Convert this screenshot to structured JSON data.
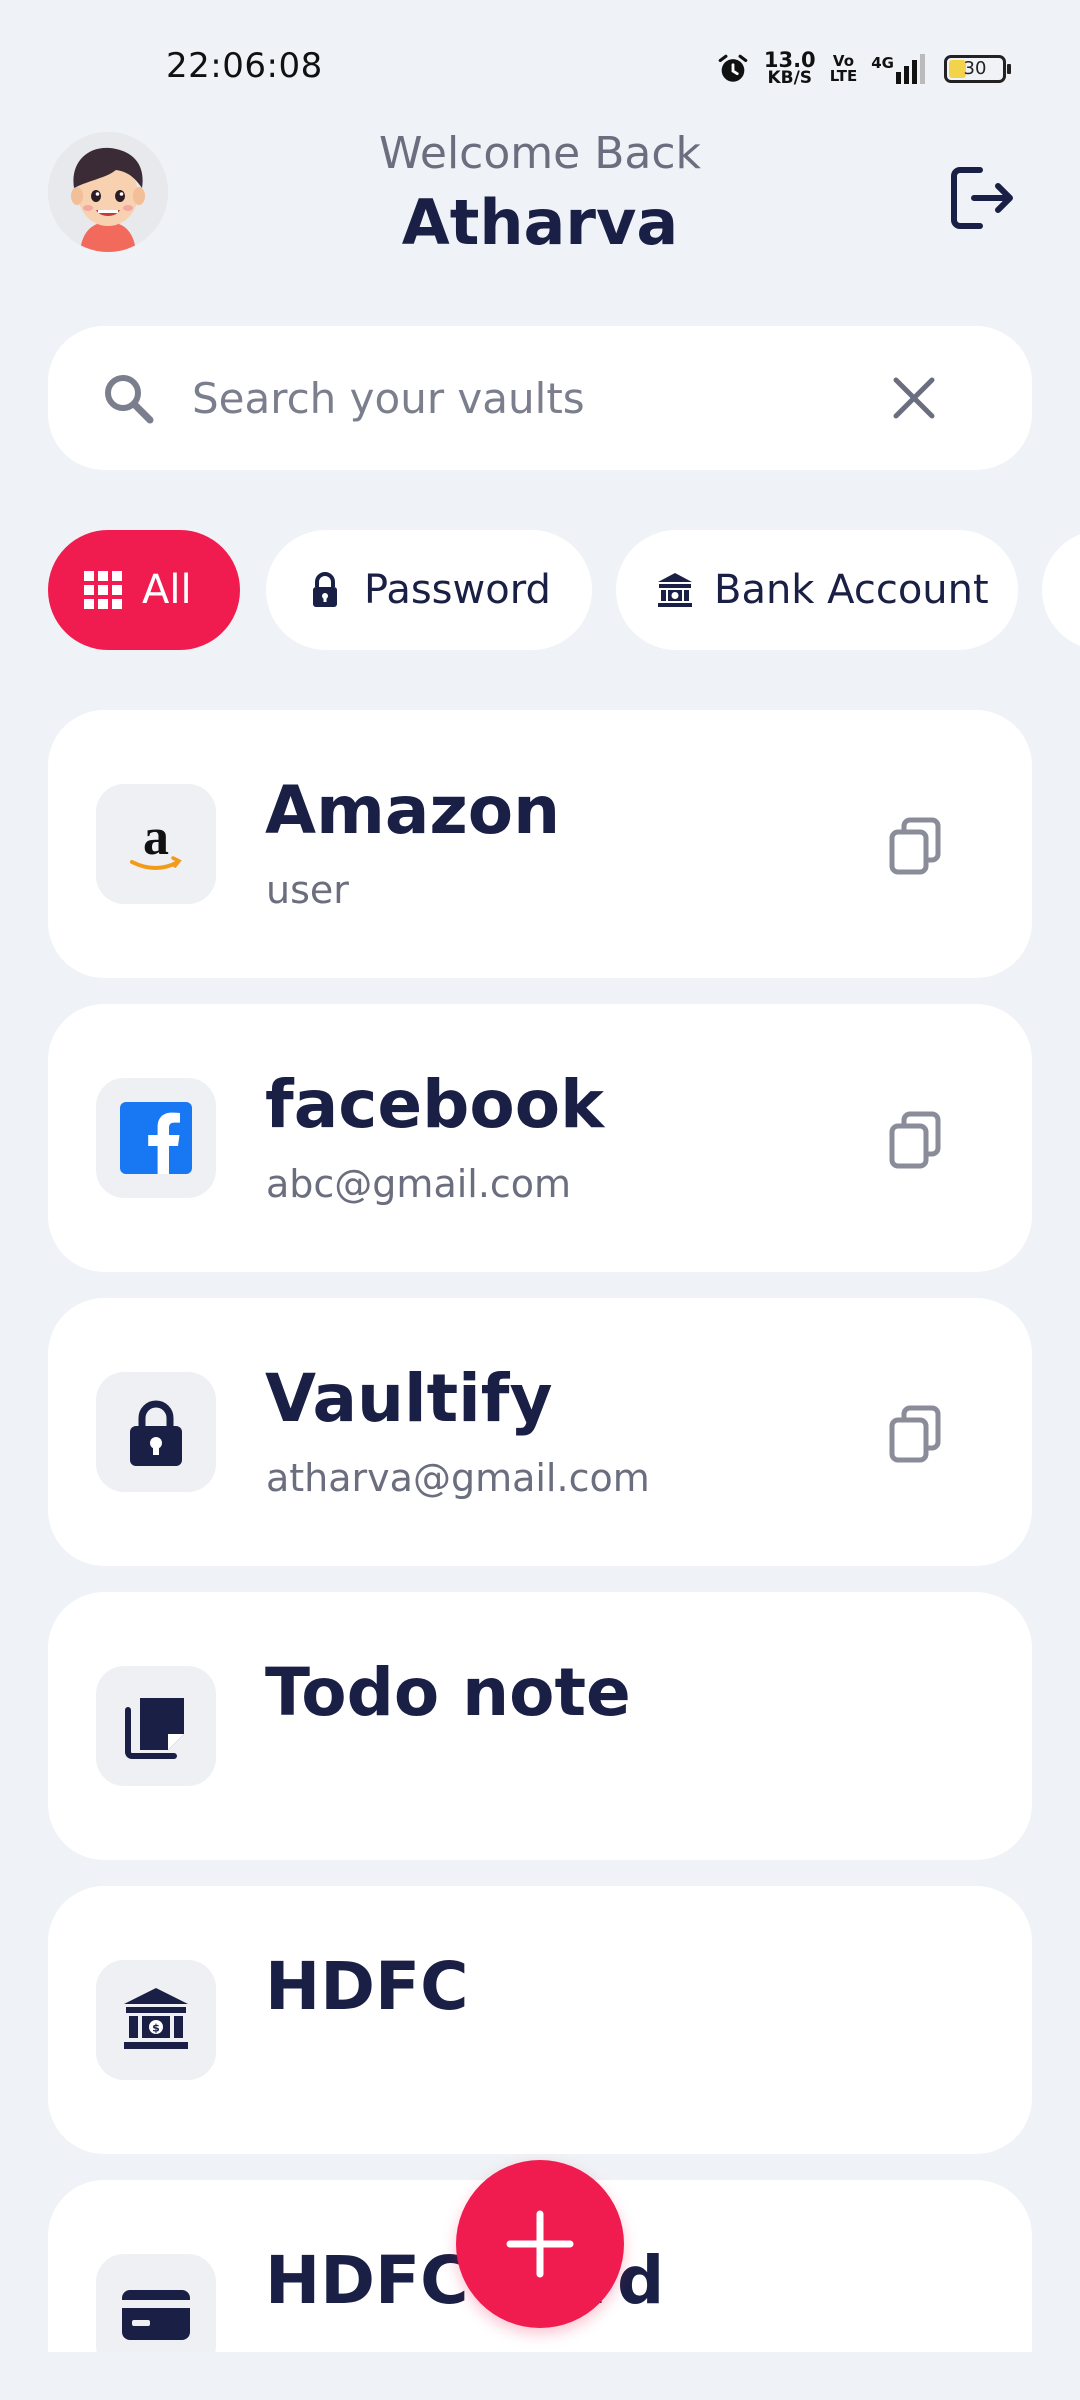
{
  "status_bar": {
    "time": "22:06:08",
    "net_speed_value": "13.0",
    "net_speed_unit": "KB/S",
    "volte_top": "Vo",
    "volte_bottom": "LTE",
    "network": "4G",
    "battery": "30",
    "icons": [
      "alarm-icon",
      "signal-icon",
      "battery-icon"
    ]
  },
  "header": {
    "welcome": "Welcome Back",
    "username": "Atharva",
    "avatar": "avatar-boy",
    "logout_icon": "logout-icon"
  },
  "search": {
    "placeholder": "Search your vaults",
    "value": "",
    "icon": "search-icon",
    "clear_icon": "close-icon"
  },
  "filters": [
    {
      "label": "All",
      "icon": "grid-icon",
      "active": true
    },
    {
      "label": "Password",
      "icon": "lock-icon",
      "active": false
    },
    {
      "label": "Bank Account",
      "icon": "bank-icon",
      "active": false
    }
  ],
  "vaults": [
    {
      "title": "Amazon",
      "subtitle": "user",
      "icon": "amazon-icon",
      "copyable": true
    },
    {
      "title": "facebook",
      "subtitle": "abc@gmail.com",
      "icon": "facebook-icon",
      "copyable": true
    },
    {
      "title": "Vaultify",
      "subtitle": "atharva@gmail.com",
      "icon": "lock-icon",
      "copyable": true
    },
    {
      "title": "Todo note",
      "subtitle": "",
      "icon": "note-icon",
      "copyable": false
    },
    {
      "title": "HDFC",
      "subtitle": "",
      "icon": "bank-icon",
      "copyable": false
    },
    {
      "title": "HDFC Card",
      "subtitle": "",
      "icon": "card-icon",
      "copyable": false
    }
  ],
  "fab": {
    "icon": "plus-icon"
  },
  "colors": {
    "accent": "#f01c4f",
    "primary_text": "#1a1f45",
    "secondary_text": "#6b6e7e",
    "background": "#eff2f6",
    "card": "#ffffff"
  }
}
